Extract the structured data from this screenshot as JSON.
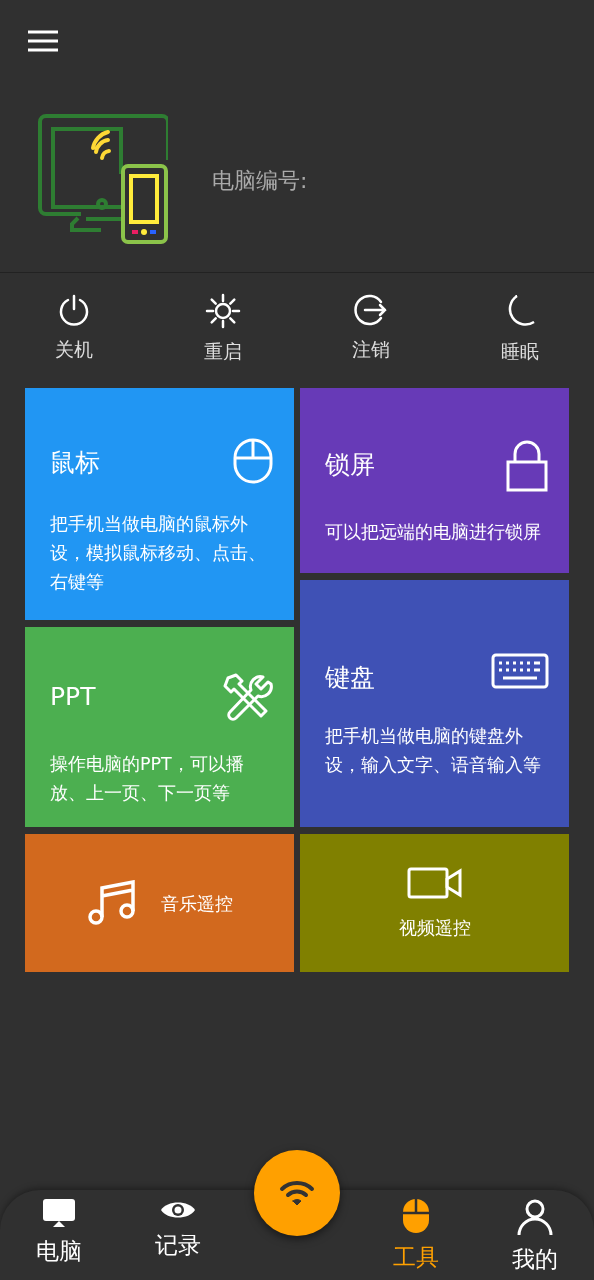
{
  "header": {
    "label": "电脑编号:"
  },
  "actions": [
    {
      "label": "关机"
    },
    {
      "label": "重启"
    },
    {
      "label": "注销"
    },
    {
      "label": "睡眠"
    }
  ],
  "tiles": [
    {
      "kind": "detail",
      "title": "鼠标",
      "description": "把手机当做电脑的鼠标外设，模拟鼠标移动、点击、右键等",
      "color": "#2196f3"
    },
    {
      "kind": "detail",
      "title": "锁屏",
      "description": "可以把远端的电脑进行锁屏",
      "color": "#673ab7"
    },
    {
      "kind": "detail",
      "title": "PPT",
      "description": "操作电脑的PPT，可以播放、上一页、下一页等",
      "color": "#4caf50"
    },
    {
      "kind": "detail",
      "title": "键盘",
      "description": "把手机当做电脑的键盘外设，输入文字、语音输入等",
      "color": "#3f51b5"
    },
    {
      "kind": "row",
      "title": "音乐遥控",
      "color": "#d2691e"
    },
    {
      "kind": "stack",
      "title": "视频遥控",
      "color": "#808000"
    }
  ],
  "nav": [
    {
      "label": "电脑",
      "selected": false
    },
    {
      "label": "记录",
      "selected": false
    },
    {
      "label": "工具",
      "selected": true
    },
    {
      "label": "我的",
      "selected": false
    }
  ]
}
